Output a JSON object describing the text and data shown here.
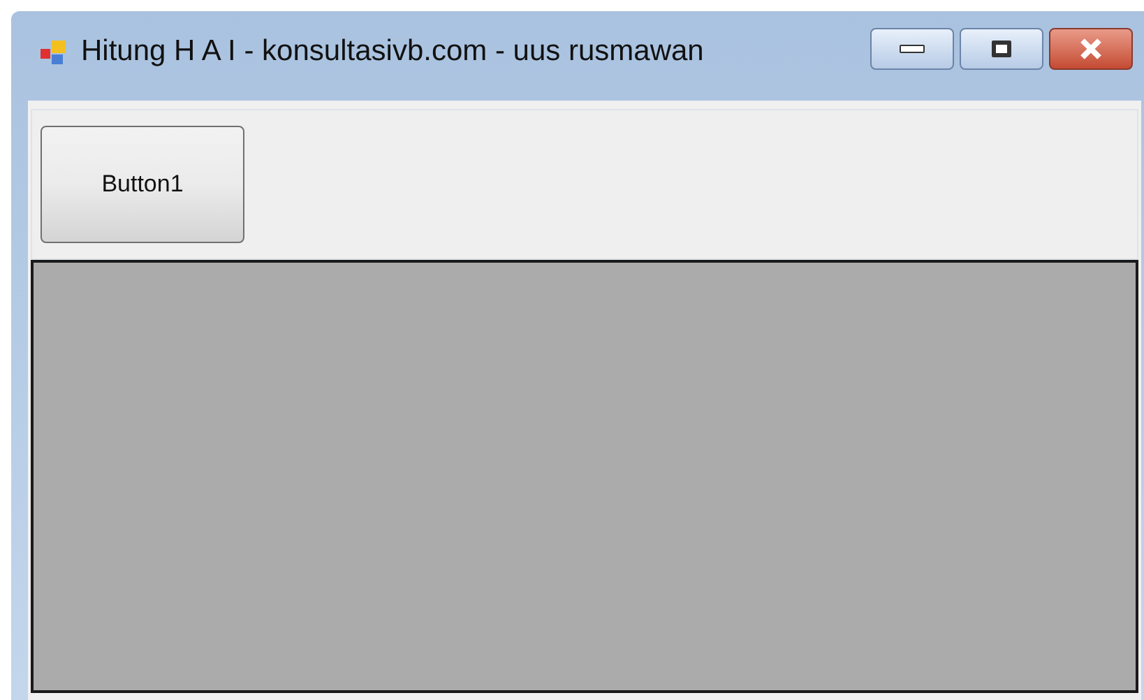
{
  "window": {
    "title": "Hitung H A I - konsultasivb.com - uus rusmawan"
  },
  "toolbar": {
    "buttons": [
      "Button1"
    ]
  }
}
